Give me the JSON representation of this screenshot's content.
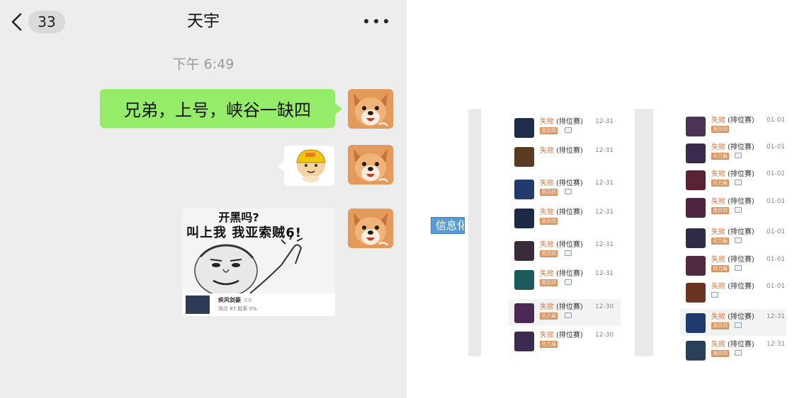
{
  "chat": {
    "unread_count": "33",
    "title": "天宇",
    "timestamp": "下午 6:49",
    "message_text": "兄弟，上号，峡谷一缺四",
    "meme": {
      "line1": "开黑吗?",
      "line2": "叫上我 我亚索贼6!",
      "footer_name": "疾风剑豪",
      "footer_badge": "亚索",
      "footer_stats": "场次 87 胜率 0%"
    }
  },
  "info_label": "信息化",
  "history": {
    "colors": {
      "loss": "#e07742",
      "tag": "#d9935e",
      "date": "#888888"
    },
    "left_column": [
      {
        "result": "失败",
        "mode": "(排位赛)",
        "date": "12-31",
        "tag": "用贝凹",
        "champ": "#1e2d4a",
        "pic": true
      },
      {
        "result": "失败",
        "mode": "(排位赛)",
        "date": "12-31",
        "tag": "",
        "champ": "#5a3a22",
        "pic": false
      },
      {
        "result": "失败",
        "mode": "(排位赛)",
        "date": "12-31",
        "tag": "用贝凹",
        "champ": "#243a6e",
        "pic": true
      },
      {
        "result": "失败",
        "mode": "(排位赛)",
        "date": "12-31",
        "tag": "用贝凹",
        "champ": "#1d2a45",
        "pic": false
      },
      {
        "result": "失败",
        "mode": "(排位赛)",
        "date": "12-31",
        "tag": "用贝凹",
        "champ": "#3a2a3a",
        "pic": true
      },
      {
        "result": "失败",
        "mode": "(排位赛)",
        "date": "12-31",
        "tag": "用贝凹",
        "champ": "#1c5a5a",
        "pic": true
      },
      {
        "result": "失败",
        "mode": "(排位赛)",
        "date": "12-30",
        "tag": "尽力局",
        "champ": "#4a2a55",
        "pic": true
      },
      {
        "result": "失败",
        "mode": "(排位赛)",
        "date": "12-30",
        "tag": "尽力局",
        "champ": "#3c2a50",
        "pic": false
      }
    ],
    "right_column": [
      {
        "result": "失败",
        "mode": "(排位赛)",
        "date": "01-01",
        "tag": "用贝凹",
        "champ": "#4a3355",
        "pic": false
      },
      {
        "result": "失败",
        "mode": "(排位赛)",
        "date": "01-01",
        "tag": "尽力局",
        "champ": "#3a2a4e",
        "pic": true
      },
      {
        "result": "失败",
        "mode": "(排位赛)",
        "date": "01-01",
        "tag": "尽力局",
        "champ": "#5a2235",
        "pic": true
      },
      {
        "result": "失败",
        "mode": "(排位赛)",
        "date": "01-01",
        "tag": "用贝凹",
        "champ": "#4e2440",
        "pic": true
      },
      {
        "result": "失败",
        "mode": "(排位赛)",
        "date": "01-01",
        "tag": "尽力局",
        "champ": "#2e2a48",
        "pic": true
      },
      {
        "result": "失败",
        "mode": "(排位赛)",
        "date": "01-01",
        "tag": "尽力局",
        "champ": "#522a40",
        "pic": true
      },
      {
        "result": "失败",
        "mode": "(排位赛)",
        "date": "01-01",
        "tag": "",
        "champ": "#6a3322",
        "pic": true
      },
      {
        "result": "失败",
        "mode": "(排位赛)",
        "date": "12-31",
        "tag": "用贝凹",
        "champ": "#1e3a70",
        "pic": true
      },
      {
        "result": "失败",
        "mode": "(排位赛)",
        "date": "12-31",
        "tag": "用贝凹",
        "champ": "#2a4058",
        "pic": true
      }
    ]
  }
}
